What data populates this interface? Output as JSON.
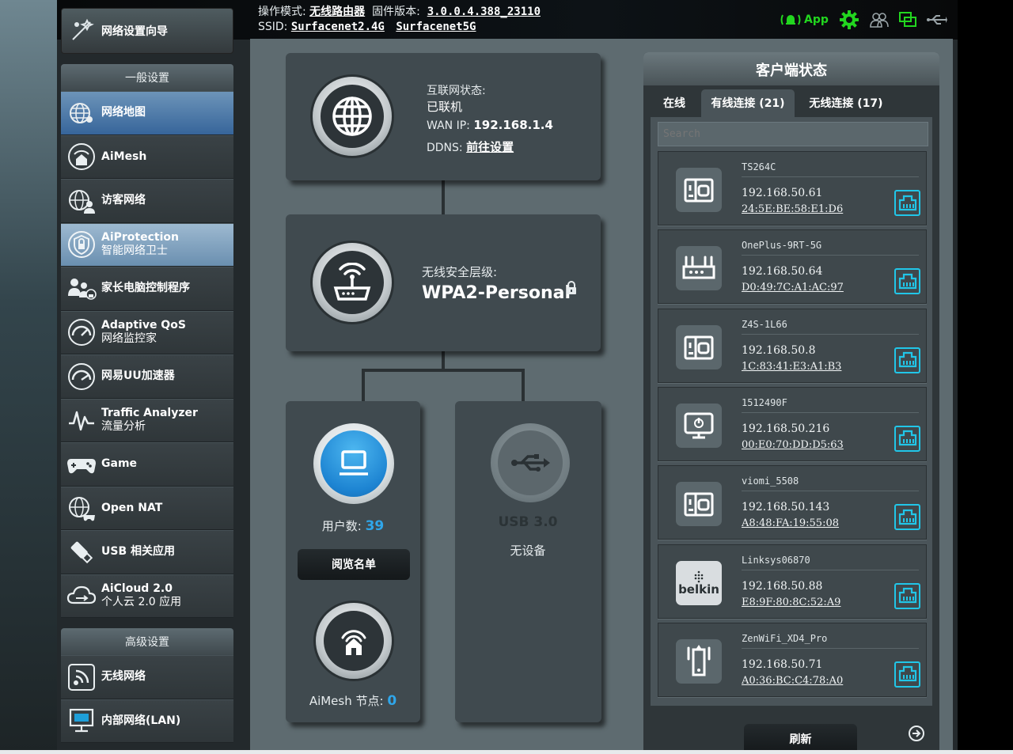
{
  "header": {
    "op_mode_label": "操作模式:",
    "op_mode_value": "无线路由器",
    "fw_label": "固件版本:",
    "fw_value": "3.0.0.4.388_23110",
    "ssid_label": "SSID:",
    "ssid_1": "Surfacenet2.4G",
    "ssid_2": "Surfacenet5G",
    "app_label": "App",
    "icons": [
      "app-icon",
      "gear-icon",
      "users-icon",
      "devices-icon",
      "usb-icon"
    ],
    "accent_green": "#22d61f"
  },
  "sidebar": {
    "qis": "网络设置向导",
    "general_title": "一般设置",
    "general_items": [
      {
        "l1": "网络地图",
        "l2": "",
        "icon": "network-map-icon",
        "state": "active"
      },
      {
        "l1": "AiMesh",
        "l2": "",
        "icon": "aimesh-icon",
        "state": ""
      },
      {
        "l1": "访客网络",
        "l2": "",
        "icon": "guest-network-icon",
        "state": ""
      },
      {
        "l1": "AiProtection",
        "l2": "智能网络卫士",
        "icon": "shield-icon",
        "state": "highlight"
      },
      {
        "l1": "家长电脑控制程序",
        "l2": "",
        "icon": "parental-icon",
        "state": ""
      },
      {
        "l1": "Adaptive QoS",
        "l2": "网络监控家",
        "icon": "speedometer-icon",
        "state": ""
      },
      {
        "l1": "网易UU加速器",
        "l2": "",
        "icon": "accelerator-icon",
        "state": ""
      },
      {
        "l1": "Traffic Analyzer",
        "l2": "流量分析",
        "icon": "traffic-icon",
        "state": ""
      },
      {
        "l1": "Game",
        "l2": "",
        "icon": "gamepad-icon",
        "state": ""
      },
      {
        "l1": "Open NAT",
        "l2": "",
        "icon": "open-nat-icon",
        "state": ""
      },
      {
        "l1": "USB 相关应用",
        "l2": "",
        "icon": "usb-app-icon",
        "state": ""
      },
      {
        "l1": "AiCloud 2.0",
        "l2": "个人云 2.0 应用",
        "icon": "cloud-icon",
        "state": ""
      }
    ],
    "advanced_title": "高级设置",
    "advanced_items": [
      {
        "l1": "无线网络",
        "icon": "wireless-icon"
      },
      {
        "l1": "内部网络(LAN)",
        "icon": "lan-icon"
      }
    ]
  },
  "map": {
    "internet_status_label": "互联网状态:",
    "internet_status_value": "已联机",
    "wan_ip_label": "WAN IP:",
    "wan_ip_value": "192.168.1.4",
    "ddns_label": "DDNS:",
    "ddns_value": "前往设置",
    "security_label": "无线安全层级:",
    "security_value": "WPA2-Personal",
    "clients_label": "用户数:",
    "clients_value": "39",
    "view_list": "阅览名单",
    "aimesh_label": "AiMesh 节点:",
    "aimesh_value": "0",
    "usb_title": "USB 3.0",
    "usb_status": "无设备",
    "accent_blue": "#2fa6ea"
  },
  "client_status": {
    "title": "客户端状态",
    "tabs": [
      "在线",
      "有线连接 (21)",
      "无线连接 (17)"
    ],
    "active_tab": 1,
    "search_placeholder": "Search",
    "refresh": "刷新",
    "devices": [
      {
        "name": "TS264C",
        "ip": "192.168.50.61",
        "mac": "24:5E:BE:58:E1:D6",
        "icon": "nas-icon"
      },
      {
        "name": "OnePlus-9RT-5G",
        "ip": "192.168.50.64",
        "mac": "D0:49:7C:A1:AC:97",
        "icon": "router-icon"
      },
      {
        "name": "Z4S-1L66",
        "ip": "192.168.50.8",
        "mac": "1C:83:41:E3:A1:B3",
        "icon": "nas-icon"
      },
      {
        "name": "1512490F",
        "ip": "192.168.50.216",
        "mac": "00:E0:70:DD:D5:63",
        "icon": "monitor-icon"
      },
      {
        "name": "viomi_5508",
        "ip": "192.168.50.143",
        "mac": "A8:48:FA:19:55:08",
        "icon": "nas-icon"
      },
      {
        "name": "Linksys06870",
        "ip": "192.168.50.88",
        "mac": "E8:9F:80:8C:52:A9",
        "icon": "belkin-logo",
        "logo_text": "belkin"
      },
      {
        "name": "ZenWiFi_XD4_Pro",
        "ip": "192.168.50.71",
        "mac": "A0:36:BC:C4:78:A0",
        "icon": "extender-icon"
      }
    ],
    "lan_badge_color": "#21c6e8"
  }
}
